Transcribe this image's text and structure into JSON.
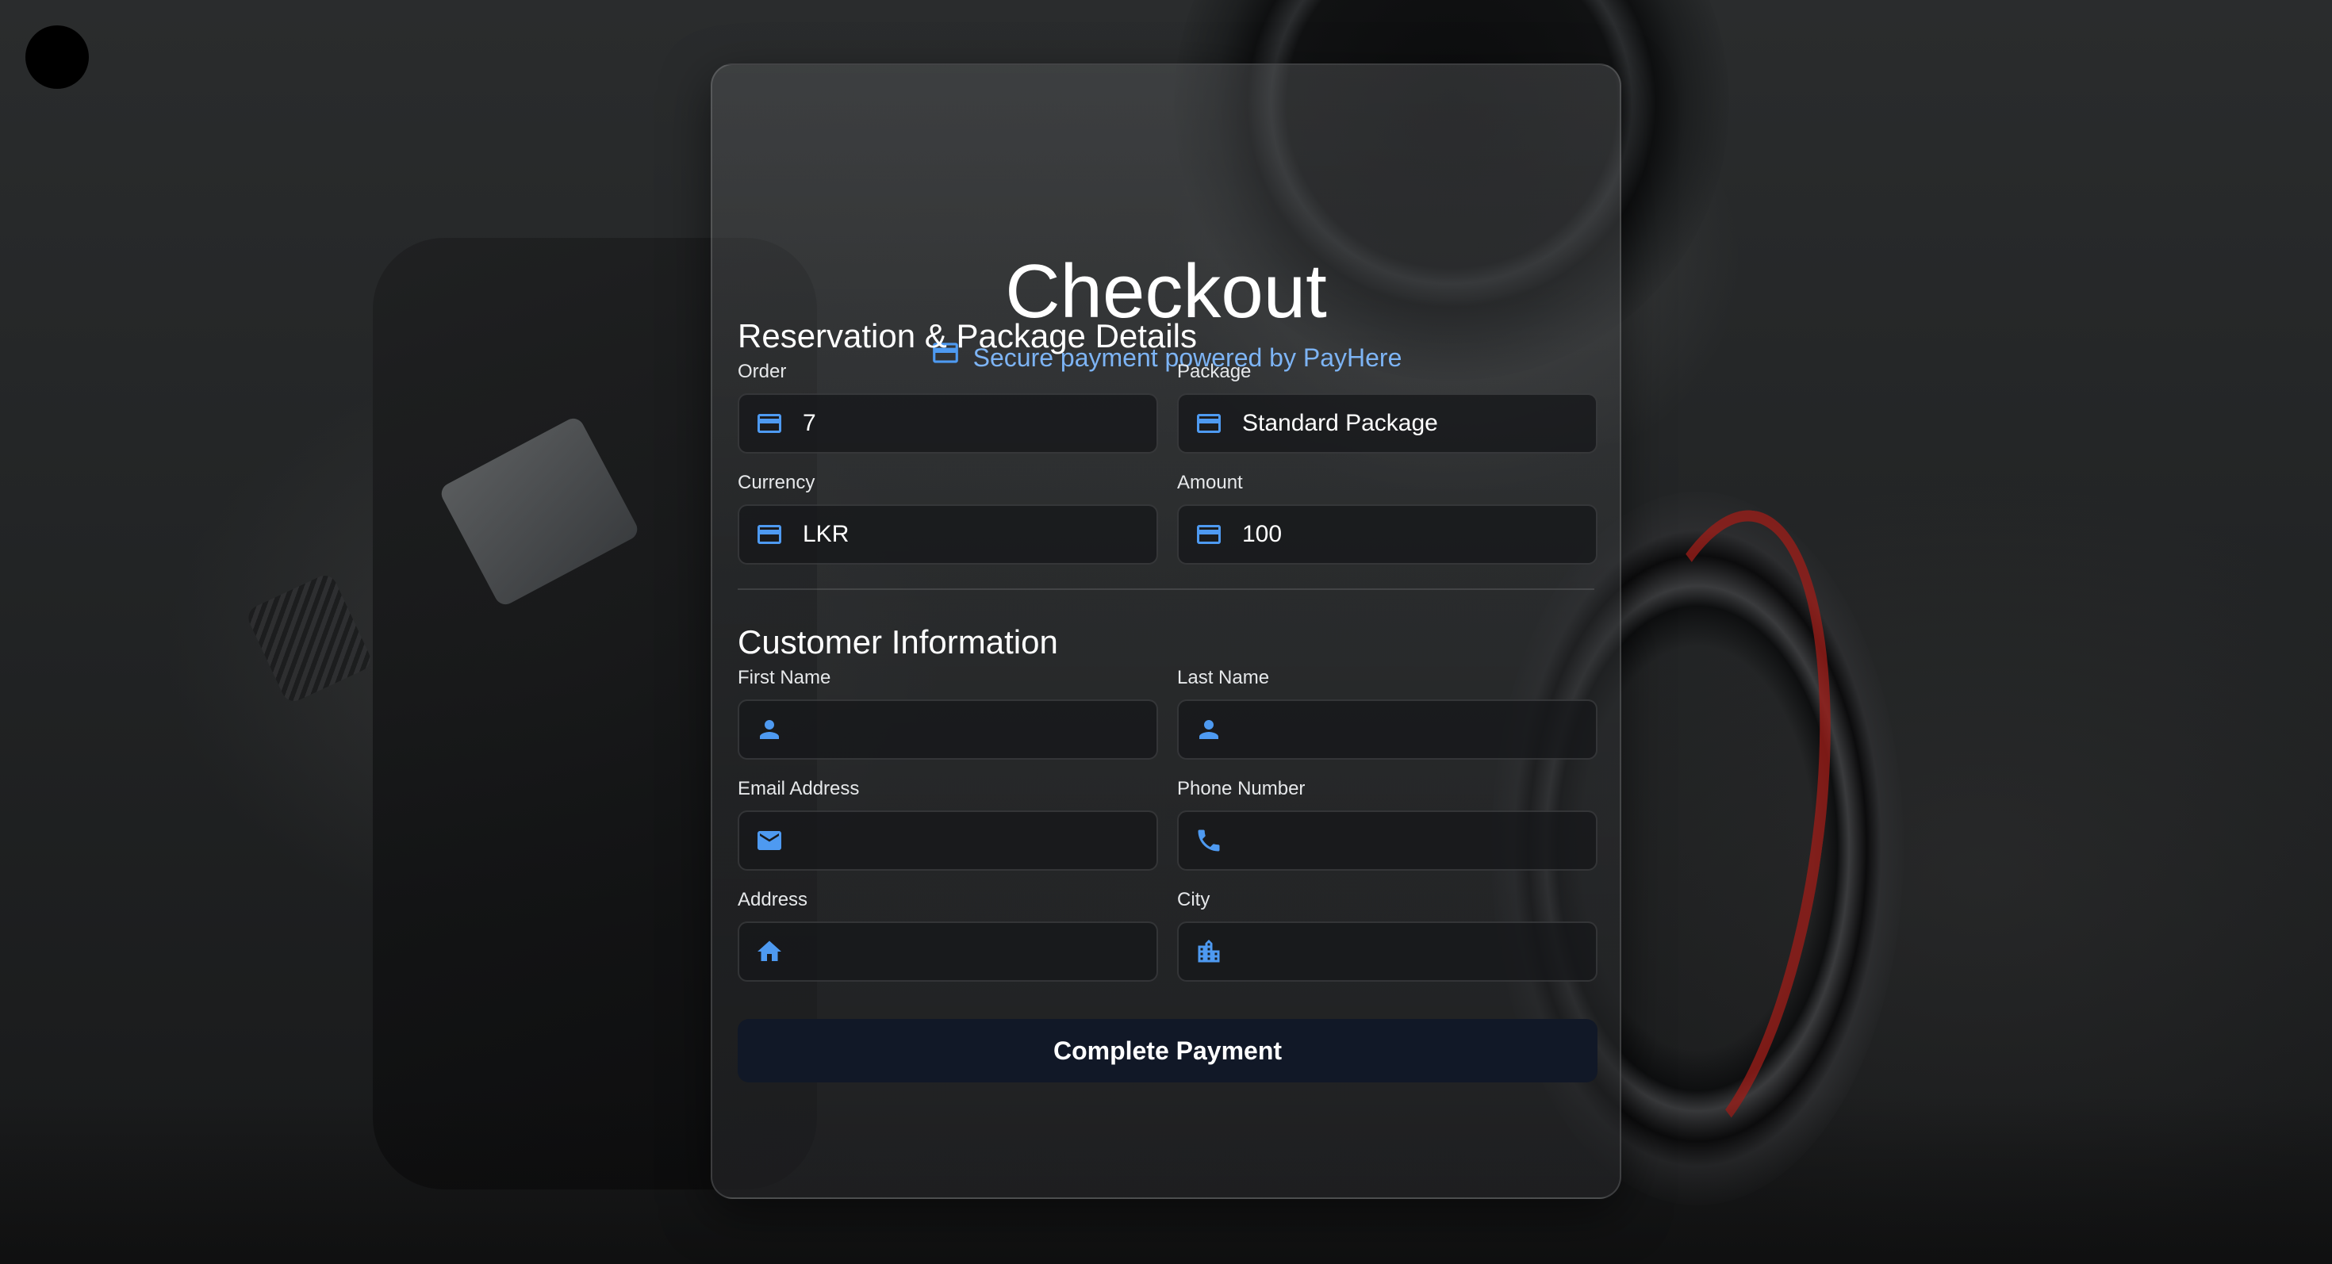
{
  "checkout": {
    "title": "Checkout",
    "subtitle": "Secure payment powered by PayHere"
  },
  "reservation": {
    "section_title": "Reservation & Package Details",
    "order": {
      "label": "Order",
      "value": "7",
      "icon": "credit-card-icon"
    },
    "package": {
      "label": "Package",
      "value": "Standard Package",
      "icon": "credit-card-icon"
    },
    "currency": {
      "label": "Currency",
      "value": "LKR",
      "icon": "credit-card-icon"
    },
    "amount": {
      "label": "Amount",
      "value": "100",
      "icon": "credit-card-icon"
    }
  },
  "customer": {
    "section_title": "Customer Information",
    "first_name": {
      "label": "First Name",
      "value": "",
      "icon": "person-icon"
    },
    "last_name": {
      "label": "Last Name",
      "value": "",
      "icon": "person-icon"
    },
    "email": {
      "label": "Email Address",
      "value": "",
      "icon": "mail-icon"
    },
    "phone": {
      "label": "Phone Number",
      "value": "",
      "icon": "phone-icon"
    },
    "address": {
      "label": "Address",
      "value": "",
      "icon": "home-icon"
    },
    "city": {
      "label": "City",
      "value": "",
      "icon": "city-icon"
    }
  },
  "submit_label": "Complete Payment",
  "colors": {
    "accent": "#4e9af1",
    "subtitle_text": "#7db4f5",
    "button_bg": "#111827"
  }
}
